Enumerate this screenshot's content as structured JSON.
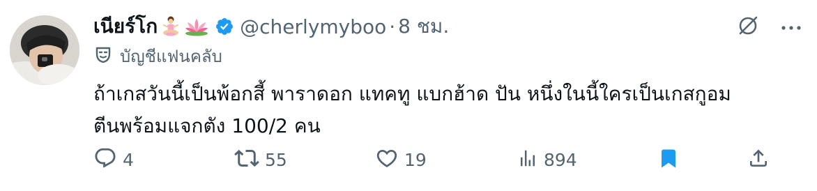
{
  "tweet": {
    "author": {
      "display_name": "เนียร์โก",
      "handle": "@cherlymyboo",
      "separator": "·",
      "time": "8 ชม.",
      "verified_icon": "blue-check-badge-icon",
      "emojis": [
        "person-in-lotus-position-emoji",
        "lotus-emoji"
      ]
    },
    "subscriber_label": "บัญชีแฟนคลับ",
    "text_lines": [
      "ถ้าเกสวันนี้เป็นพ้อกสี้ พาราดอก แทคทู แบกฮ้าด ปัน หนึ่งในนี้ใครเป็นเกสกูอม",
      "ตีนพร้อมแจกตัง 100/2 คน"
    ],
    "actions": {
      "reply_count": "4",
      "retweet_count": "55",
      "like_count": "19",
      "view_count": "894"
    },
    "icons": {
      "grok": "grok-slash-icon",
      "more": "more-dots-icon",
      "bookmark": "bookmark-filled-icon",
      "share": "share-icon"
    },
    "colors": {
      "accent": "#1d9bf0",
      "text": "#0f1419",
      "muted": "#536471"
    }
  }
}
